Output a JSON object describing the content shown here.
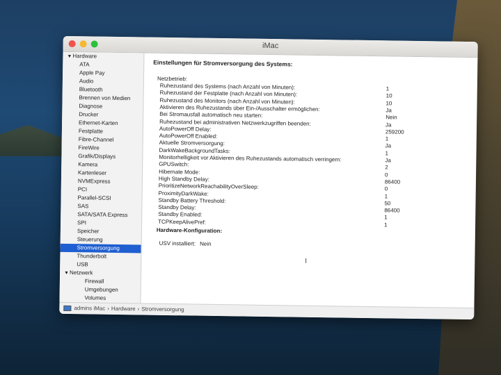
{
  "window": {
    "title": "iMac"
  },
  "sidebar": {
    "hardware_label": "Hardware",
    "hardware_items": [
      "ATA",
      "Apple Pay",
      "Audio",
      "Bluetooth",
      "Brennen von Medien",
      "Diagnose",
      "Drucker",
      "Ethernet-Karten",
      "Festplatte",
      "Fibre-Channel",
      "FireWire",
      "Grafik/Displays",
      "Kamera",
      "Kartenleser",
      "NVMExpress",
      "PCI",
      "Parallel-SCSI",
      "SAS",
      "SATA/SATA Express",
      "SPI",
      "Speicher",
      "Steuerung",
      "Stromversorgung",
      "Thunderbolt",
      "USB"
    ],
    "selected": "Stromversorgung",
    "network_label": "Netzwerk",
    "network_items": [
      "Firewall",
      "Umgebungen",
      "Volumes"
    ]
  },
  "content": {
    "heading": "Einstellungen für Stromversorgung des Systems:",
    "netzbetrieb_label": "Netzbetrieb:",
    "settings": [
      {
        "k": "Ruhezustand des Systems (nach Anzahl von Minuten):",
        "v": "1"
      },
      {
        "k": "Ruhezustand der Festplatte (nach Anzahl von Minuten):",
        "v": "10"
      },
      {
        "k": "Ruhezustand des Monitors (nach Anzahl von Minuten):",
        "v": "10"
      },
      {
        "k": "Aktivieren des Ruhezustands über Ein-/Ausschalter ermöglichen:",
        "v": "Ja"
      },
      {
        "k": "Bei Stromausfall automatisch neu starten:",
        "v": "Nein"
      },
      {
        "k": "Ruhezustand bei administrativen Netzwerkzugriffen beenden:",
        "v": "Ja"
      },
      {
        "k": "AutoPowerOff Delay:",
        "v": "259200"
      },
      {
        "k": "AutoPowerOff Enabled:",
        "v": "1"
      },
      {
        "k": "Aktuelle Stromversorgung:",
        "v": "Ja"
      },
      {
        "k": "DarkWakeBackgroundTasks:",
        "v": "1"
      },
      {
        "k": "Monitorhelligkeit vor Aktivieren des Ruhezustands automatisch verringern:",
        "v": "Ja"
      },
      {
        "k": "GPUSwitch:",
        "v": "2"
      },
      {
        "k": "Hibernate Mode:",
        "v": "0"
      },
      {
        "k": "High Standby Delay:",
        "v": "86400"
      },
      {
        "k": "PrioritizeNetworkReachabilityOverSleep:",
        "v": "0"
      },
      {
        "k": "ProximityDarkWake:",
        "v": "1"
      },
      {
        "k": "Standby Battery Threshold:",
        "v": "50"
      },
      {
        "k": "Standby Delay:",
        "v": "86400"
      },
      {
        "k": "Standby Enabled:",
        "v": "1"
      },
      {
        "k": "TCPKeepAlivePref:",
        "v": "1"
      }
    ],
    "hw_heading": "Hardware-Konfiguration:",
    "usv_label": "USV installiert:",
    "usv_value": "Nein"
  },
  "statusbar": {
    "crumbs": [
      "admins iMac",
      "Hardware",
      "Stromversorgung"
    ],
    "separator": "›"
  }
}
